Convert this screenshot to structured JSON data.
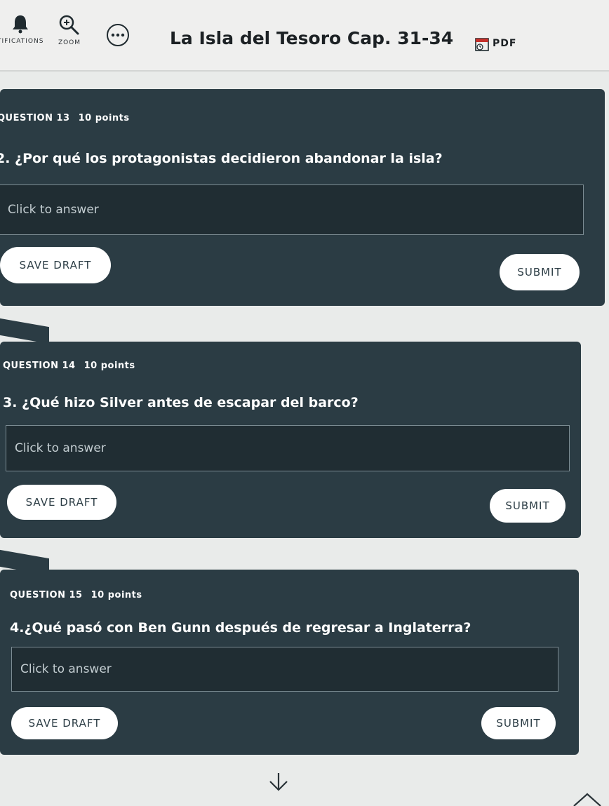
{
  "header": {
    "notifications_label": "TIFICATIONS",
    "zoom_label": "ZOOM",
    "title": "La Isla del Tesoro Cap. 31-34",
    "pdf_label": "PDF"
  },
  "questions": [
    {
      "heading": "QUESTION 13",
      "points": "10 points",
      "text": "2. ¿Por qué los protagonistas decidieron abandonar la isla?",
      "answer_placeholder": "Click to answer",
      "save_label": "SAVE DRAFT",
      "submit_label": "SUBMIT"
    },
    {
      "heading": "QUESTION 14",
      "points": "10 points",
      "text": "3. ¿Qué hizo Silver antes de escapar del barco?",
      "answer_placeholder": "Click to answer",
      "save_label": "SAVE DRAFT",
      "submit_label": "SUBMIT"
    },
    {
      "heading": "QUESTION 15",
      "points": "10 points",
      "text": "4.¿Qué pasó con Ben Gunn después de regresar a Inglaterra?",
      "answer_placeholder": "Click to answer",
      "save_label": "SAVE DRAFT",
      "submit_label": "SUBMIT"
    }
  ],
  "colors": {
    "card_bg": "#2b3c44",
    "answer_bg": "#202d33",
    "page_bg": "#e9ebea"
  }
}
